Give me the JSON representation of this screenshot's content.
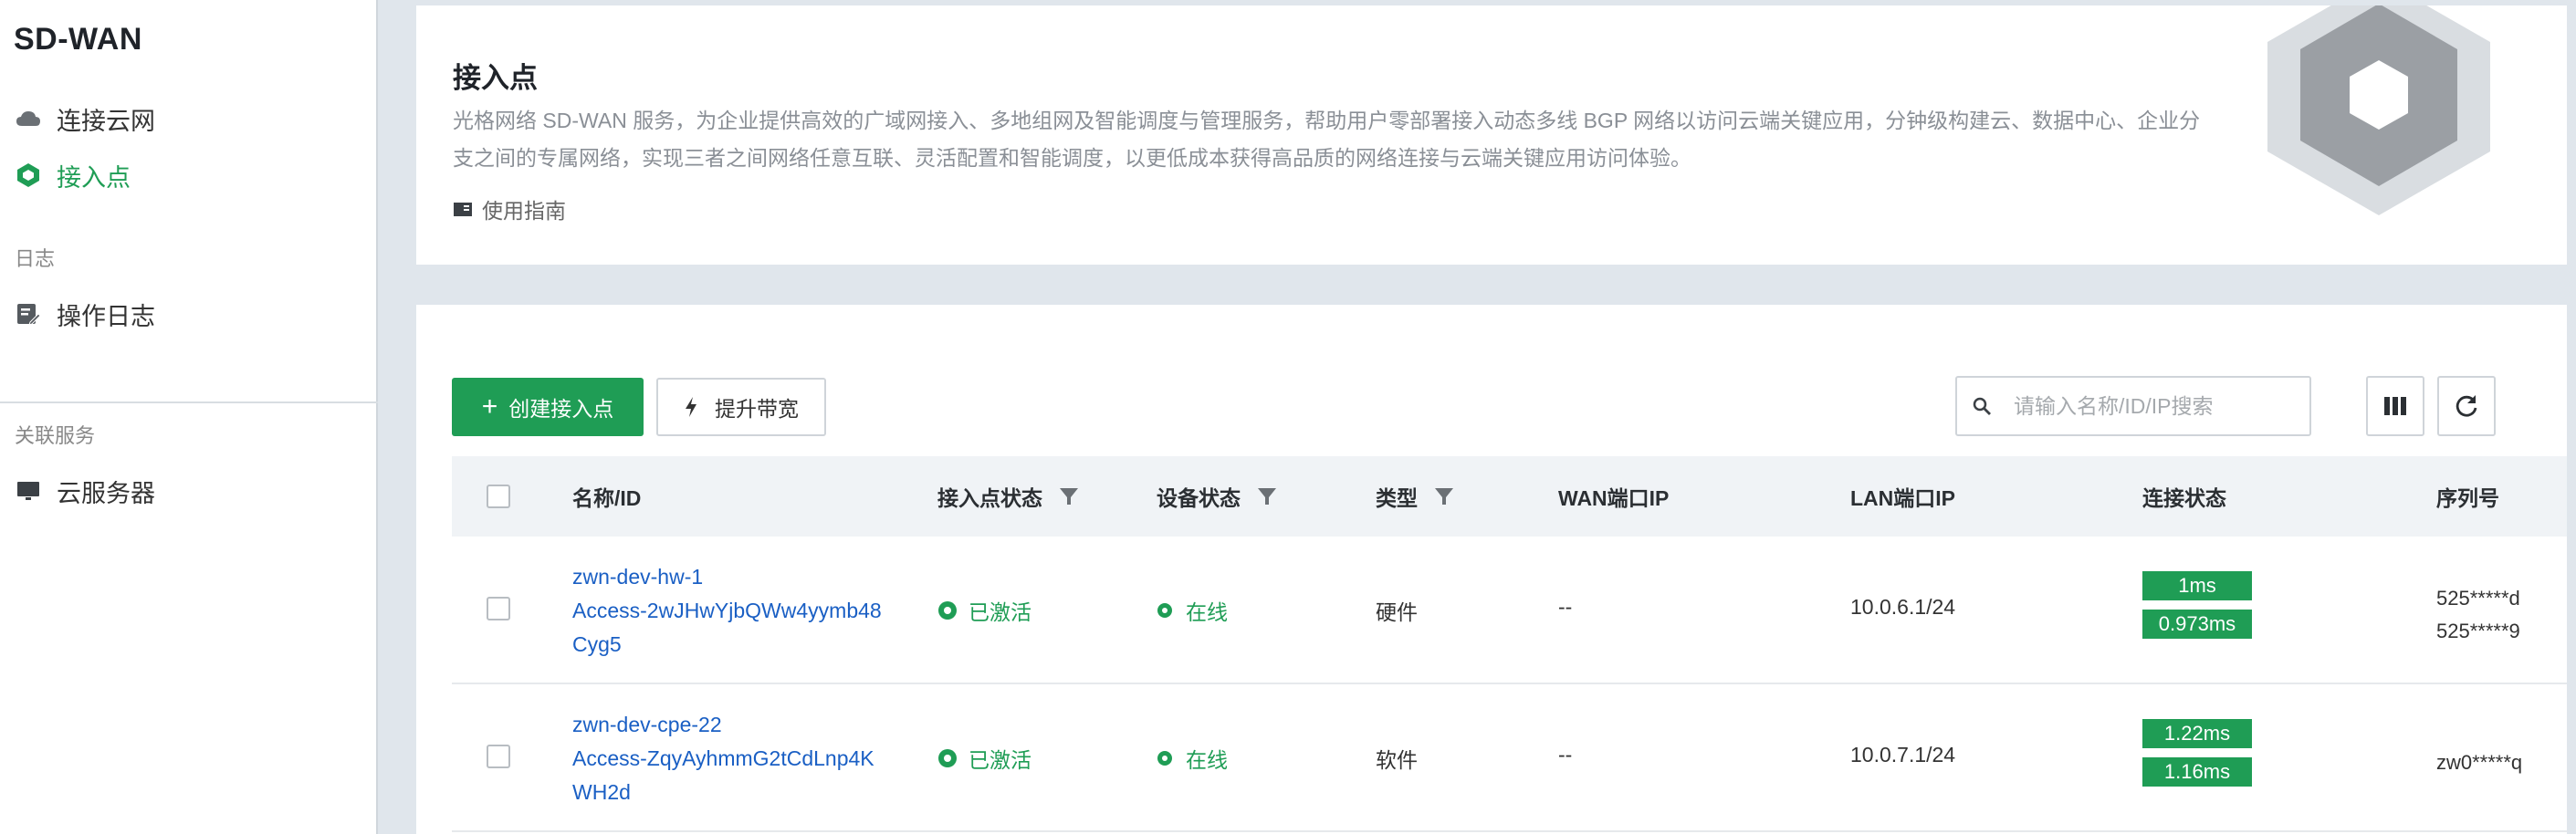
{
  "sidebar": {
    "app_title": "SD-WAN",
    "items": [
      {
        "label": "连接云网",
        "icon": "cloud-icon"
      },
      {
        "label": "接入点",
        "icon": "hexagon-icon",
        "active": true
      }
    ],
    "log_group": {
      "title": "日志",
      "items": [
        {
          "label": "操作日志",
          "icon": "edit-log-icon"
        }
      ]
    },
    "related_group": {
      "title": "关联服务",
      "items": [
        {
          "label": "云服务器",
          "icon": "monitor-icon"
        }
      ]
    }
  },
  "intro": {
    "title": "接入点",
    "description": "光格网络 SD-WAN 服务，为企业提供高效的广域网接入、多地组网及智能调度与管理服务，帮助用户零部署接入动态多线 BGP 网络以访问云端关键应用，分钟级构建云、数据中心、企业分支之间的专属网络，实现三者之间网络任意互联、灵活配置和智能调度，以更低成本获得高品质的网络连接与云端关键应用访问体验。",
    "guide_label": "使用指南"
  },
  "toolbar": {
    "create_label": "创建接入点",
    "upgrade_label": "提升带宽",
    "search_placeholder": "请输入名称/ID/IP搜索",
    "search_value": ""
  },
  "table": {
    "columns": {
      "name": "名称/ID",
      "ap_status": "接入点状态",
      "device_status": "设备状态",
      "type": "类型",
      "wan_ip": "WAN端口IP",
      "lan_ip": "LAN端口IP",
      "conn_status": "连接状态",
      "serial": "序列号"
    },
    "rows": [
      {
        "name": "zwn-dev-hw-1",
        "id": "Access-2wJHwYjbQWw4yymb48Cyg5",
        "ap_status": "已激活",
        "device_status": "在线",
        "type": "硬件",
        "wan_ip": "--",
        "lan_ip": "10.0.6.1/24",
        "latency_1": "1ms",
        "latency_2": "0.973ms",
        "serial_1": "525*****d",
        "serial_2": "525*****9"
      },
      {
        "name": "zwn-dev-cpe-22",
        "id": "Access-ZqyAyhmmG2tCdLnp4KWH2d",
        "ap_status": "已激活",
        "device_status": "在线",
        "type": "软件",
        "wan_ip": "--",
        "lan_ip": "10.0.7.1/24",
        "latency_1": "1.22ms",
        "latency_2": "1.16ms",
        "serial_1": "zw0*****q"
      }
    ]
  },
  "colors": {
    "accent": "#1f9d55",
    "link": "#1a5fc4",
    "page_bg": "#e0e6ec",
    "header_bg": "#f0f3f6"
  }
}
